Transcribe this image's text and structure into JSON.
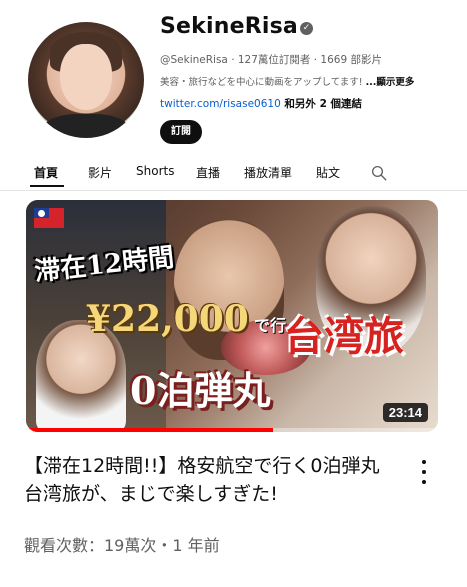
{
  "channel": {
    "name": "SekineRisa",
    "verified_icon": "verified-check-icon",
    "meta": "@SekineRisa · 127萬位訂閱者 · 1669 部影片",
    "description": "美容・旅行などを中心に動画をアップしてます! ",
    "description_more": "...顯示更多",
    "link_url": "twitter.com/risase0610",
    "link_extra": " 和另外 2 個連結",
    "subscribe_label": "訂閱"
  },
  "tabs": [
    {
      "label": "首頁",
      "active": true
    },
    {
      "label": "影片"
    },
    {
      "label": "Shorts"
    },
    {
      "label": "直播"
    },
    {
      "label": "播放清單"
    },
    {
      "label": "貼文"
    }
  ],
  "search_icon": "search-icon",
  "video": {
    "thumbnail_text": {
      "line1": "滞在12時間",
      "line2": "¥22,000",
      "line3": "で行く",
      "line4": "台湾旅",
      "line5": "0泊弾丸"
    },
    "duration": "23:14",
    "progress": 0.6,
    "title": "【滞在12時間!!】格安航空で行く0泊弾丸台湾旅が、まじで楽しすぎた!",
    "meta": "觀看次數：19萬次・1 年前"
  },
  "colors": {
    "accent_red": "#ff0000",
    "link_blue": "#065fd4",
    "text_secondary": "#606060"
  }
}
